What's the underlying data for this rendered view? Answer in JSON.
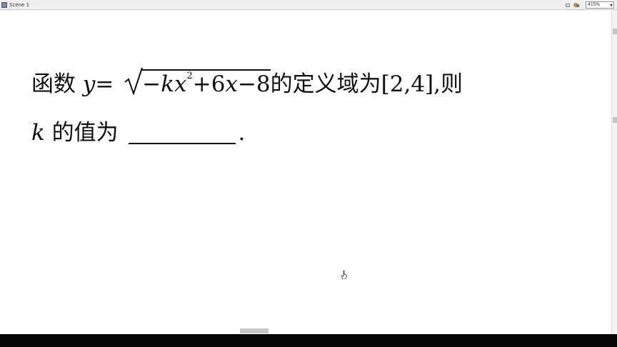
{
  "toolbar": {
    "scene_tab": "Scene 1",
    "zoom": "415%"
  },
  "question": {
    "line1_prefix": "函数",
    "var_y": "y",
    "equals": "=",
    "radicand_sign": "−",
    "radicand_k": "k",
    "radicand_x": "x",
    "radicand_exp": "2",
    "radicand_rest": "+6",
    "radicand_x2": "x",
    "radicand_tail": "−8",
    "line1_suffix": "的定义域为[2,4],则",
    "var_k": "k",
    "line2_text": "的值为",
    "period": "."
  }
}
